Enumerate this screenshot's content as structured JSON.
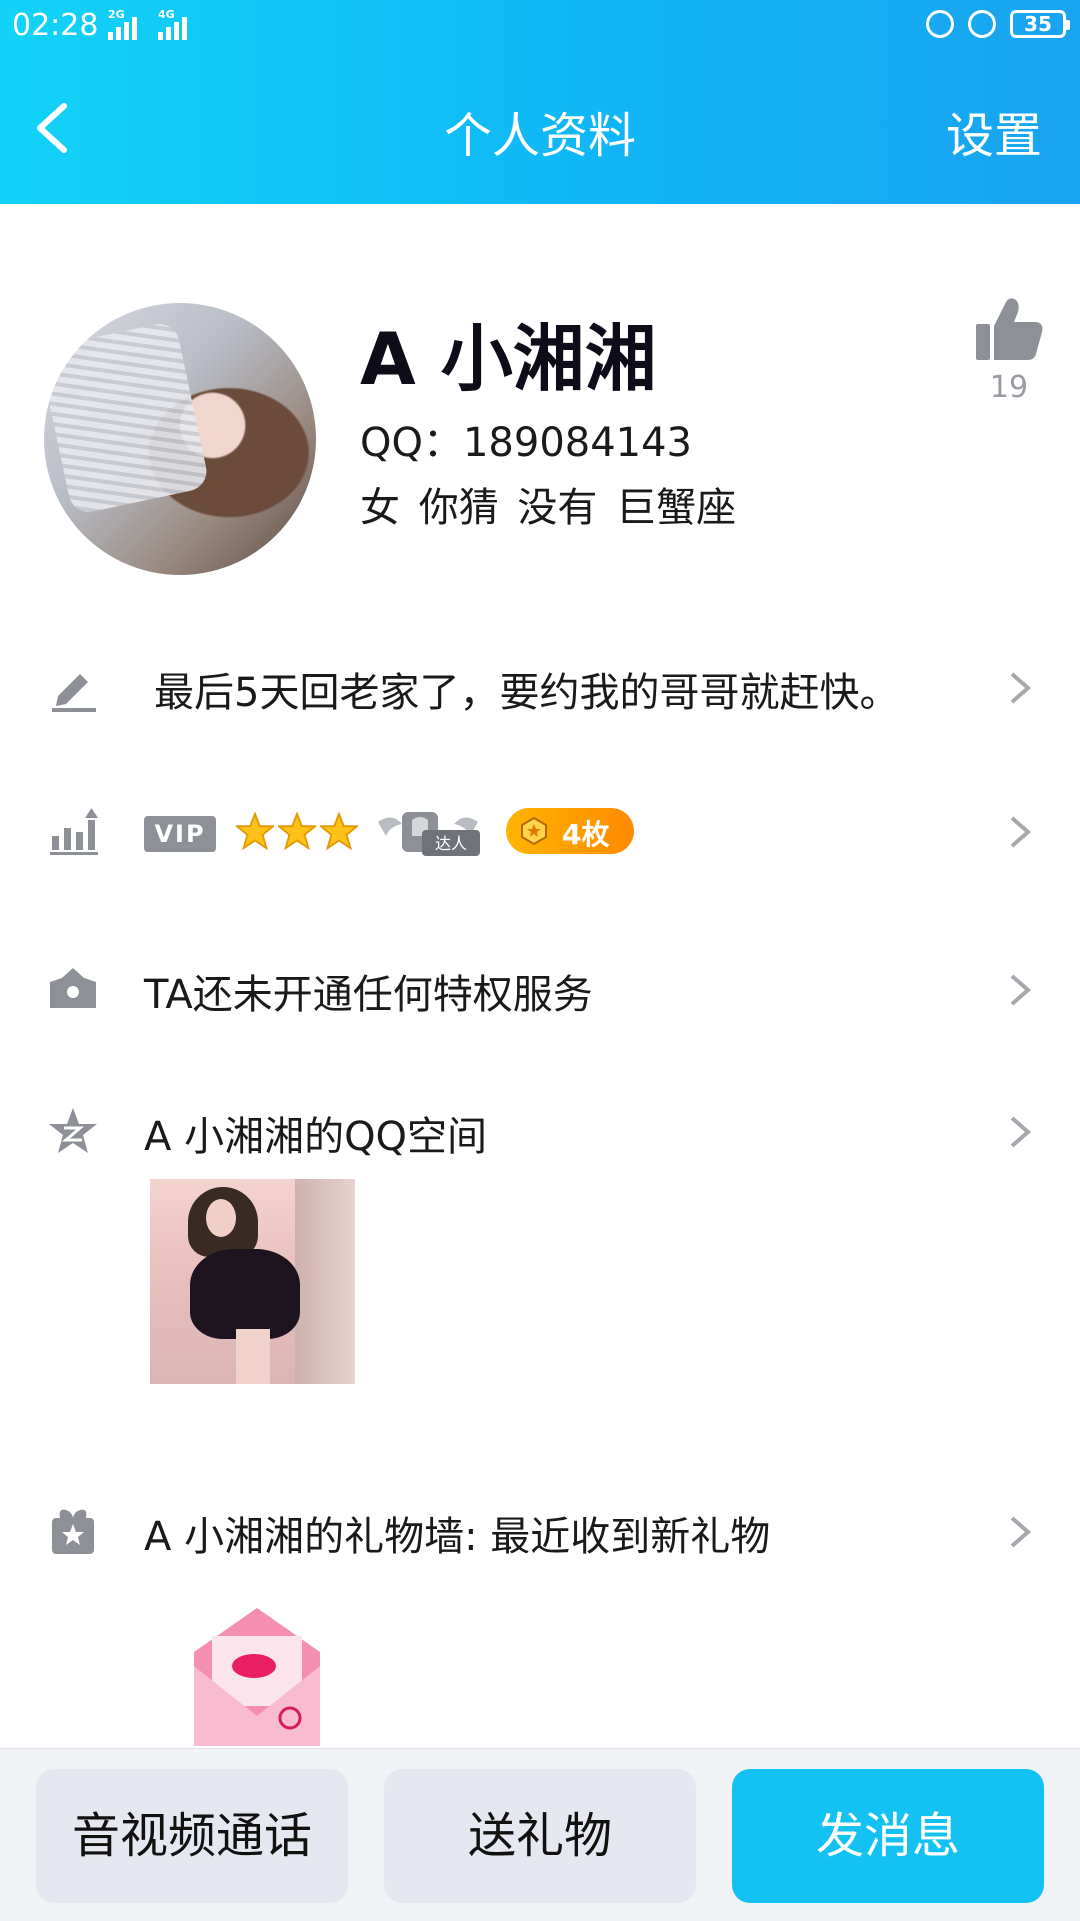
{
  "status_bar": {
    "time": "02:28",
    "network_1": "2G",
    "network_2": "4G",
    "battery": "35"
  },
  "header": {
    "title": "个人资料",
    "settings_label": "设置"
  },
  "profile": {
    "name": "A 小湘湘",
    "qq": "QQ：189084143",
    "info": "女  你猜  没有  巨蟹座",
    "likes": "19"
  },
  "rows": {
    "signature": "最后5天回老家了，要约我的哥哥就赶快。",
    "vip_label": "VIP",
    "star_count": 3,
    "daren_label": "达人",
    "medal_label": "4枚",
    "privilege": "TA还未开通任何特权服务",
    "qzone": "A 小湘湘的QQ空间",
    "gift_wall": "A 小湘湘的礼物墙: 最近收到新礼物"
  },
  "bottom_bar": {
    "call_label": "音视频通话",
    "gift_label": "送礼物",
    "message_label": "发消息"
  },
  "colors": {
    "header_start": "#12d3f7",
    "header_end": "#1aa3f0",
    "accent_button": "#13c2f3",
    "icon_gray": "#8d9096",
    "medal_orange": "#ff9a00"
  },
  "icons": [
    "back-chevron-icon",
    "thumbs-up-icon",
    "pencil-icon",
    "level-chart-icon",
    "crown-icon",
    "qzone-star-icon",
    "gift-box-icon",
    "chevron-right-icon"
  ]
}
